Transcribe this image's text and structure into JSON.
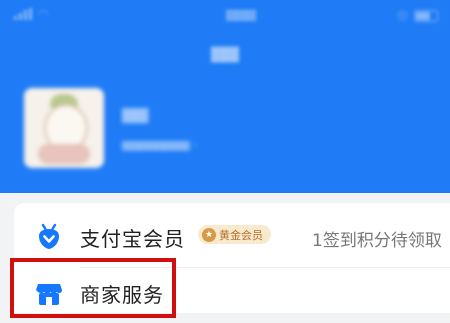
{
  "colors": {
    "header_blue": "#1f7cf6",
    "member_icon_blue": "#1677ff",
    "badge_bg": "#f9e9cf",
    "badge_text": "#b5712a",
    "highlight_red": "#d10f0f"
  },
  "menu": {
    "member": {
      "icon": "alipay-member-shield-icon",
      "label": "支付宝会员",
      "badge": "黄金会员",
      "badge_icon": "star-badge-icon",
      "right_text": "1签到积分待领取"
    },
    "merchant": {
      "icon": "merchant-store-icon",
      "label": "商家服务"
    }
  }
}
